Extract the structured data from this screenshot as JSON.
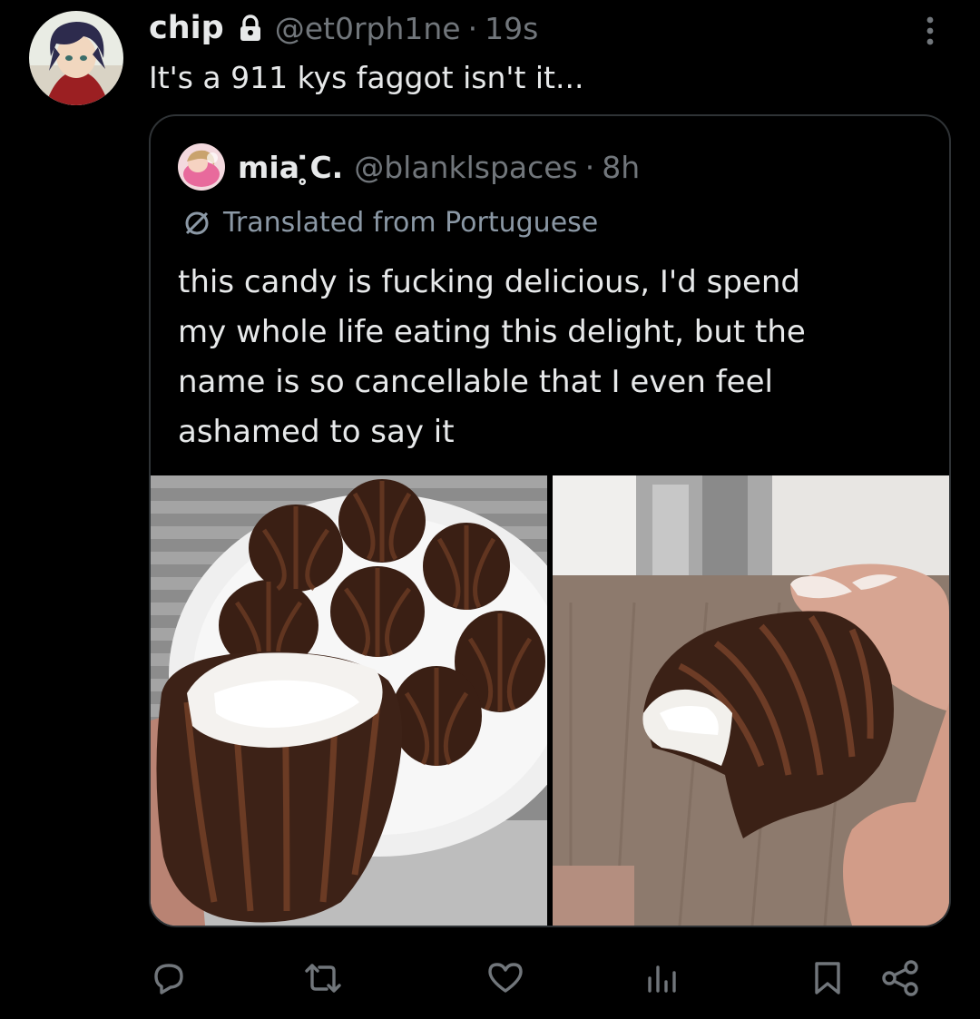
{
  "tweet": {
    "display_name": "chip",
    "handle": "@et0rph1ne",
    "dot": "·",
    "time": "19s",
    "text": "It's a 911 kys faggot isn't it...",
    "icons": {
      "lock": "lock-icon",
      "more": "more-vertical-icon"
    }
  },
  "quote": {
    "display_name": "mia ̥̇C.",
    "handle": "@blanklspaces",
    "dot": "·",
    "time": "8h",
    "translated_label": "Translated from Portuguese",
    "text_lines": [
      "this candy is fucking delicious, I'd spend",
      "my whole life eating this delight, but the",
      "name is so cancellable that I even feel",
      "ashamed to say it"
    ],
    "media": [
      {
        "icon": "chocolate-marshmallow-plate-photo"
      },
      {
        "icon": "hand-holding-bitten-candy-photo"
      }
    ]
  },
  "actions": [
    {
      "name": "reply",
      "icon": "reply-icon"
    },
    {
      "name": "retweet",
      "icon": "retweet-icon"
    },
    {
      "name": "like",
      "icon": "heart-icon"
    },
    {
      "name": "views",
      "icon": "views-icon"
    },
    {
      "name": "bookmark",
      "icon": "bookmark-icon"
    },
    {
      "name": "share",
      "icon": "share-icon"
    }
  ],
  "colors": {
    "background": "#000000",
    "text_primary": "#e7e9ea",
    "text_secondary": "#71767b",
    "border": "#2f3336"
  }
}
